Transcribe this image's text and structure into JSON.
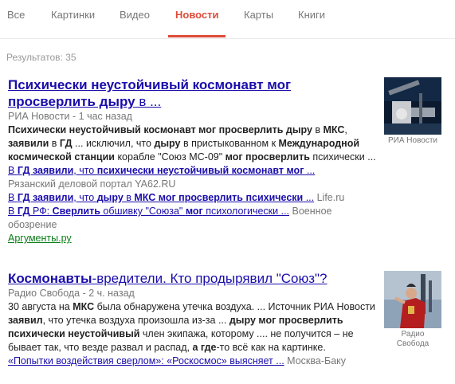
{
  "tabs": [
    {
      "label": "Все"
    },
    {
      "label": "Картинки"
    },
    {
      "label": "Видео"
    },
    {
      "label": "Новости",
      "active": true
    },
    {
      "label": "Карты"
    },
    {
      "label": "Книги"
    }
  ],
  "results_count": "Результатов: 35",
  "results": [
    {
      "title_bold": "Психически неустойчивый космонавт мог просверлить дыру",
      "title_rest": " в ...",
      "source": "РИА Новости",
      "time": " - 1 час назад",
      "snippet": {
        "b1": "Психически неустойчивый космонавт мог просверлить дыру",
        "t2": " в ",
        "b3": "МКС",
        "t4": ", ",
        "b5": "заявили",
        "t6": " в ",
        "b7": "ГД",
        "t8": " ... исключил, что ",
        "b9": "дыру",
        "t10": " в пристыкованном к ",
        "b11": "Международной космической станции",
        "t12": " корабле \"Союз МС-09\" ",
        "b13": "мог просверлить",
        "t14": " психически ..."
      },
      "related": [
        {
          "p1": "В ",
          "b2": "ГД заявили",
          "p3": ", что ",
          "b4": "психически неустойчивый космонавт мог",
          "p5": " ...",
          "source": "Рязанский деловой портал YA62.RU"
        },
        {
          "p1": "В ",
          "b2": "ГД заявили",
          "p3": ", что ",
          "b4": "дыру",
          "p5": " в ",
          "b6": "МКС мог просверлить психически",
          "p7": " ...",
          "source": "Life.ru"
        },
        {
          "p1": "В ",
          "b2": "ГД",
          "p3": " РФ: ",
          "b4": "Сверлить",
          "p5": " обшивку \"Союза\" ",
          "b6": "мог",
          "p7": " психологически ...",
          "source_line1": "Военное",
          "source_line2": "обозрение"
        }
      ],
      "more_link": "Аргументы.ру",
      "thumb_caption": "РИА Новости"
    },
    {
      "title_bold": "Космонавты",
      "title_rest": "-вредители. Кто продырявил \"Союз\"?",
      "source": "Радио Свобода",
      "time": " - 2 ч. назад",
      "snippet": {
        "t1": "30 августа на ",
        "b2": "МКС",
        "t3": " была обнаружена утечка воздуха. ... Источник РИА Новости ",
        "b4": "заявил",
        "t5": ", что утечка воздуха произошла из-за ... ",
        "b6": "дыру мог просверлить психически неустойчивый",
        "t7": " член экипажа, которому .... не получится – не бывает так, что везде развал и распад, ",
        "b8": "а где",
        "t9": "-то всё как на картинке."
      },
      "related": [
        {
          "link": "«Попытки воздействия сверлом»: «Роскосмос» выясняет ...",
          "source": "Москва-Баку"
        }
      ],
      "thumb_caption_line1": "Радио",
      "thumb_caption_line2": "Свобода"
    }
  ],
  "colors": {
    "link": "#1a0dab",
    "active_tab": "#dd4b39",
    "green_link": "#0a7d17",
    "muted": "#777777"
  }
}
